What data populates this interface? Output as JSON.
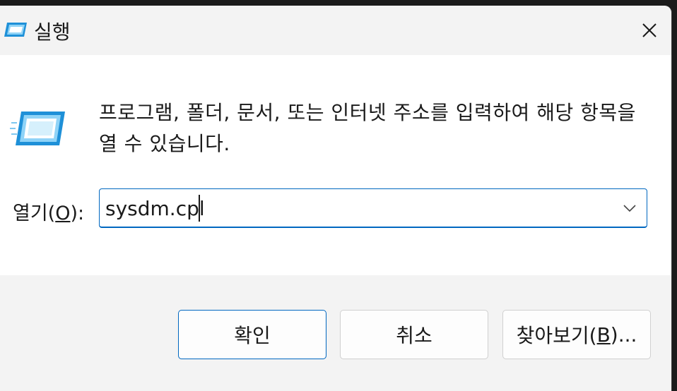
{
  "window": {
    "title": "실행",
    "close_label": "닫기"
  },
  "body": {
    "description": "프로그램, 폴더, 문서, 또는 인터넷 주소를 입력하여 해당 항목을 열 수 있습니다.",
    "open_label_prefix": "열기(",
    "open_label_key": "O",
    "open_label_suffix": "):",
    "input_value": "sysdm.cpl"
  },
  "buttons": {
    "ok": "확인",
    "cancel": "취소",
    "browse_prefix": "찾아보기(",
    "browse_key": "B",
    "browse_suffix": ")..."
  },
  "colors": {
    "accent": "#0067c0",
    "icon_blue": "#29a3e8"
  }
}
